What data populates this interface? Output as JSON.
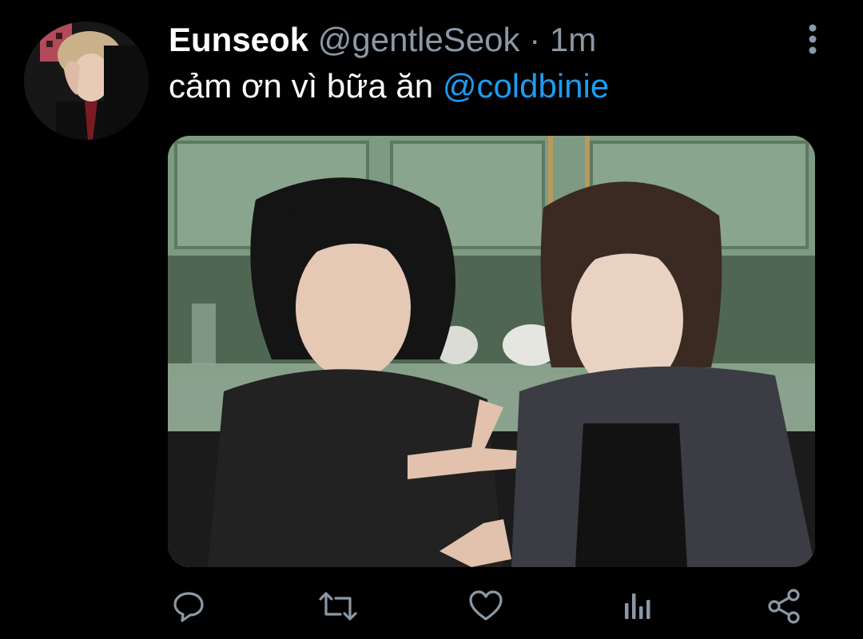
{
  "tweet": {
    "display_name": "Eunseok",
    "handle": "@gentleSeok",
    "separator": "·",
    "time": "1m",
    "text": "cảm ơn vì bữa ăn",
    "mention": "@coldbinie"
  },
  "avatar": {
    "description_icon": "profile-photo"
  },
  "media": {
    "icon": "photo-image"
  },
  "actions": {
    "reply": {
      "icon": "reply-icon"
    },
    "retweet": {
      "icon": "retweet-icon"
    },
    "like": {
      "icon": "like-icon"
    },
    "analytics": {
      "icon": "analytics-icon"
    },
    "share": {
      "icon": "share-icon"
    }
  },
  "colors": {
    "background": "#000000",
    "text": "#ffffff",
    "secondary": "#8b98a5",
    "link": "#1d9bf0"
  }
}
